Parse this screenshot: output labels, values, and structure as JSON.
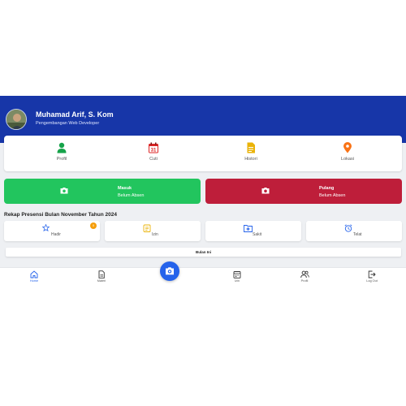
{
  "user": {
    "name": "Muhamad Arif, S. Kom",
    "role": "Pengembangan Web Developer"
  },
  "menu": [
    {
      "label": "Profil",
      "icon": "user-icon",
      "color": "#16a34a"
    },
    {
      "label": "Cuti",
      "icon": "calendar-icon",
      "color": "#dc2626",
      "icon_text": "31"
    },
    {
      "label": "Histori",
      "icon": "document-icon",
      "color": "#eab308"
    },
    {
      "label": "Lokasi",
      "icon": "map-pin-icon",
      "color": "#f97316"
    }
  ],
  "attendance": {
    "masuk": {
      "title": "Masuk",
      "status": "Belum Absen",
      "color": "#22c55e"
    },
    "pulang": {
      "title": "Pulang",
      "status": "Belum Absen",
      "color": "#be1e3a"
    }
  },
  "recap": {
    "title": "Rekap Presensi Bulan November Tahun 2024",
    "stats": [
      {
        "label": "Hadir",
        "icon": "person-star-icon",
        "badge": "0"
      },
      {
        "label": "Izin",
        "icon": "clipboard-icon"
      },
      {
        "label": "Sakit",
        "icon": "medical-folder-icon"
      },
      {
        "label": "Telat",
        "icon": "alarm-clock-icon"
      }
    ],
    "month_button": "Bulan Ini"
  },
  "nav": [
    {
      "label": "Home",
      "icon": "home-icon",
      "active": true
    },
    {
      "label": "Materi",
      "icon": "file-icon"
    },
    {
      "label": "Izin",
      "icon": "calendar-grid-icon"
    },
    {
      "label": "Profil",
      "icon": "users-icon"
    },
    {
      "label": "Log Out",
      "icon": "logout-icon"
    }
  ],
  "colors": {
    "header": "#1736a8",
    "primary": "#2563eb",
    "background": "#eef0f3"
  }
}
